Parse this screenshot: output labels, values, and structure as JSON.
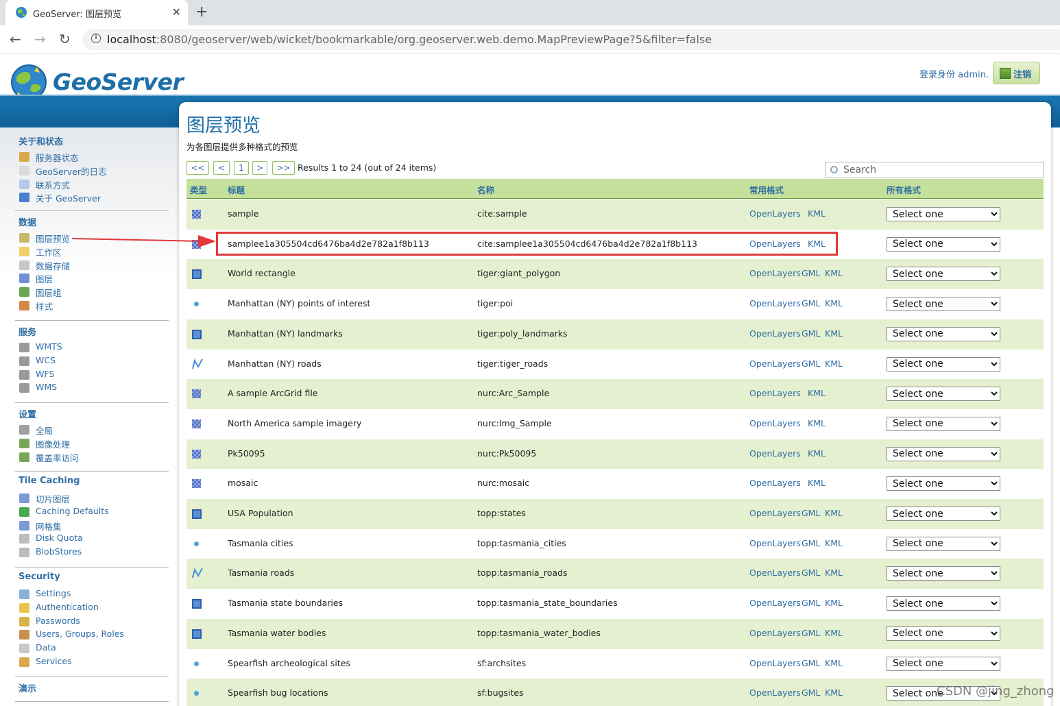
{
  "browser": {
    "tab_title": "GeoServer: 图层预览",
    "close_glyph": "✕",
    "new_tab_glyph": "+",
    "back_glyph": "←",
    "forward_glyph": "→",
    "reload_glyph": "↻",
    "url_host": "localhost",
    "url_rest": ":8080/geoserver/web/wicket/bookmarkable/org.geoserver.web.demo.MapPreviewPage?5&filter=false"
  },
  "header": {
    "logo_text": "GeoServer",
    "login_as": "登录身份 admin.",
    "logout_label": "注销"
  },
  "sidebar": {
    "sections": [
      {
        "title": "关于和状态",
        "items": [
          {
            "label": "服务器状态",
            "icon": "server-status-icon",
            "color": "#d8a84a"
          },
          {
            "label": "GeoServer的日志",
            "icon": "log-icon",
            "color": "#d9d9d9"
          },
          {
            "label": "联系方式",
            "icon": "contact-icon",
            "color": "#b7c9e6"
          },
          {
            "label": "关于 GeoServer",
            "icon": "about-icon",
            "color": "#4a7fcf"
          }
        ]
      },
      {
        "title": "数据",
        "items": [
          {
            "label": "图层预览",
            "icon": "layer-preview-icon",
            "color": "#c9b86a"
          },
          {
            "label": "工作区",
            "icon": "workspace-icon",
            "color": "#f0cf6a"
          },
          {
            "label": "数据存储",
            "icon": "datastore-icon",
            "color": "#c8c8c8"
          },
          {
            "label": "图层",
            "icon": "layers-icon",
            "color": "#6f8fd8"
          },
          {
            "label": "图层组",
            "icon": "layer-group-icon",
            "color": "#6aa84f"
          },
          {
            "label": "样式",
            "icon": "styles-icon",
            "color": "#d4894a"
          }
        ]
      },
      {
        "title": "服务",
        "items": [
          {
            "label": "WMTS",
            "icon": "wmts-icon",
            "color": "#9a9a9a"
          },
          {
            "label": "WCS",
            "icon": "wcs-icon",
            "color": "#9a9a9a"
          },
          {
            "label": "WFS",
            "icon": "wfs-icon",
            "color": "#9a9a9a"
          },
          {
            "label": "WMS",
            "icon": "wms-icon",
            "color": "#9a9a9a"
          }
        ]
      },
      {
        "title": "设置",
        "items": [
          {
            "label": "全局",
            "icon": "global-settings-icon",
            "color": "#a0a0a0"
          },
          {
            "label": "图像处理",
            "icon": "image-processing-icon",
            "color": "#7aa65a"
          },
          {
            "label": "覆盖率访问",
            "icon": "coverage-access-icon",
            "color": "#7aa65a"
          }
        ]
      },
      {
        "title": "Tile Caching",
        "items": [
          {
            "label": "切片图层",
            "icon": "tile-layers-icon",
            "color": "#7b9ad6"
          },
          {
            "label": "Caching Defaults",
            "icon": "caching-defaults-icon",
            "color": "#4aa84f"
          },
          {
            "label": "网格集",
            "icon": "gridsets-icon",
            "color": "#7b9ad6"
          },
          {
            "label": "Disk Quota",
            "icon": "disk-quota-icon",
            "color": "#bdbdbd"
          },
          {
            "label": "BlobStores",
            "icon": "blobstores-icon",
            "color": "#bdbdbd"
          }
        ]
      },
      {
        "title": "Security",
        "items": [
          {
            "label": "Settings",
            "icon": "security-settings-icon",
            "color": "#8ab0d8"
          },
          {
            "label": "Authentication",
            "icon": "authentication-icon",
            "color": "#e8c54a"
          },
          {
            "label": "Passwords",
            "icon": "passwords-icon",
            "color": "#d8b24a"
          },
          {
            "label": "Users, Groups, Roles",
            "icon": "users-icon",
            "color": "#c89050"
          },
          {
            "label": "Data",
            "icon": "data-security-icon",
            "color": "#c8c8c8"
          },
          {
            "label": "Services",
            "icon": "services-security-icon",
            "color": "#d8a84a"
          }
        ]
      },
      {
        "title": "演示",
        "items": []
      }
    ]
  },
  "main": {
    "title": "图层预览",
    "description": "为各图层提供多种格式的预览",
    "pager": {
      "first": "<<",
      "prev": "<",
      "page": "1",
      "next": ">",
      "last": ">>",
      "info": "Results 1 to 24 (out of 24 items)"
    },
    "search_placeholder": "Search",
    "columns": {
      "type": "类型",
      "title": "标题",
      "name": "名称",
      "common": "常用格式",
      "all": "所有格式"
    },
    "select_placeholder": "Select one",
    "rows": [
      {
        "type": "raster",
        "title": "sample",
        "name": "cite:sample",
        "formats": [
          "OpenLayers",
          "KML"
        ]
      },
      {
        "type": "raster",
        "title": "samplee1a305504cd6476ba4d2e782a1f8b113",
        "name": "cite:samplee1a305504cd6476ba4d2e782a1f8b113",
        "formats": [
          "OpenLayers",
          "KML"
        ]
      },
      {
        "type": "polygon",
        "title": "World rectangle",
        "name": "tiger:giant_polygon",
        "formats": [
          "OpenLayers",
          "GML",
          "KML"
        ]
      },
      {
        "type": "point",
        "title": "Manhattan (NY) points of interest",
        "name": "tiger:poi",
        "formats": [
          "OpenLayers",
          "GML",
          "KML"
        ]
      },
      {
        "type": "polygon",
        "title": "Manhattan (NY) landmarks",
        "name": "tiger:poly_landmarks",
        "formats": [
          "OpenLayers",
          "GML",
          "KML"
        ]
      },
      {
        "type": "line",
        "title": "Manhattan (NY) roads",
        "name": "tiger:tiger_roads",
        "formats": [
          "OpenLayers",
          "GML",
          "KML"
        ]
      },
      {
        "type": "raster",
        "title": "A sample ArcGrid file",
        "name": "nurc:Arc_Sample",
        "formats": [
          "OpenLayers",
          "KML"
        ]
      },
      {
        "type": "raster",
        "title": "North America sample imagery",
        "name": "nurc:Img_Sample",
        "formats": [
          "OpenLayers",
          "KML"
        ]
      },
      {
        "type": "raster",
        "title": "Pk50095",
        "name": "nurc:Pk50095",
        "formats": [
          "OpenLayers",
          "KML"
        ]
      },
      {
        "type": "raster",
        "title": "mosaic",
        "name": "nurc:mosaic",
        "formats": [
          "OpenLayers",
          "KML"
        ]
      },
      {
        "type": "polygon",
        "title": "USA Population",
        "name": "topp:states",
        "formats": [
          "OpenLayers",
          "GML",
          "KML"
        ]
      },
      {
        "type": "point",
        "title": "Tasmania cities",
        "name": "topp:tasmania_cities",
        "formats": [
          "OpenLayers",
          "GML",
          "KML"
        ]
      },
      {
        "type": "line",
        "title": "Tasmania roads",
        "name": "topp:tasmania_roads",
        "formats": [
          "OpenLayers",
          "GML",
          "KML"
        ]
      },
      {
        "type": "polygon",
        "title": "Tasmania state boundaries",
        "name": "topp:tasmania_state_boundaries",
        "formats": [
          "OpenLayers",
          "GML",
          "KML"
        ]
      },
      {
        "type": "polygon",
        "title": "Tasmania water bodies",
        "name": "topp:tasmania_water_bodies",
        "formats": [
          "OpenLayers",
          "GML",
          "KML"
        ]
      },
      {
        "type": "point",
        "title": "Spearfish archeological sites",
        "name": "sf:archsites",
        "formats": [
          "OpenLayers",
          "GML",
          "KML"
        ]
      },
      {
        "type": "point",
        "title": "Spearfish bug locations",
        "name": "sf:bugsites",
        "formats": [
          "OpenLayers",
          "GML",
          "KML"
        ]
      }
    ]
  },
  "annotation": {
    "highlight_color": "#e2383a"
  },
  "watermark": "CSDN @jing_zhong"
}
